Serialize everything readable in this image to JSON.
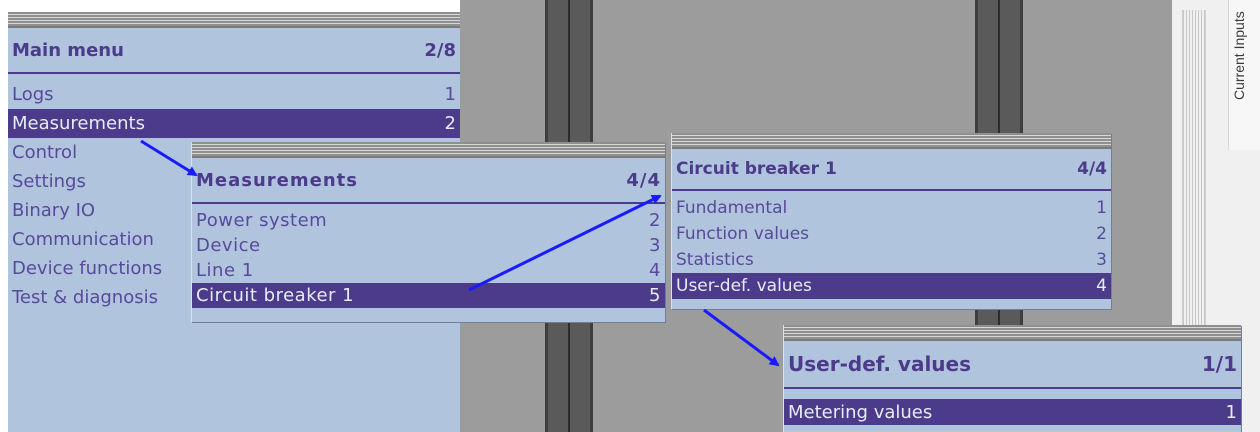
{
  "main_menu": {
    "title": "Main menu",
    "count": "2/8",
    "items": [
      {
        "label": "Logs",
        "num": "1"
      },
      {
        "label": "Measurements",
        "num": "2"
      },
      {
        "label": "Control",
        "num": ""
      },
      {
        "label": "Settings",
        "num": ""
      },
      {
        "label": "Binary IO",
        "num": ""
      },
      {
        "label": "Communication",
        "num": ""
      },
      {
        "label": "Device functions",
        "num": ""
      },
      {
        "label": "Test & diagnosis",
        "num": ""
      }
    ],
    "selected_index": 1
  },
  "measurements_menu": {
    "title": "Measurements",
    "count": "4/4",
    "items": [
      {
        "label": "Power system",
        "num": "2"
      },
      {
        "label": "Device",
        "num": "3"
      },
      {
        "label": "Line 1",
        "num": "4"
      },
      {
        "label": "Circuit breaker 1",
        "num": "5"
      }
    ],
    "selected_index": 3
  },
  "circuit_breaker_menu": {
    "title": "Circuit breaker 1",
    "count": "4/4",
    "items": [
      {
        "label": "Fundamental",
        "num": "1"
      },
      {
        "label": "Function values",
        "num": "2"
      },
      {
        "label": "Statistics",
        "num": "3"
      },
      {
        "label": "User-def. values",
        "num": "4"
      }
    ],
    "selected_index": 3
  },
  "user_def_menu": {
    "title": "User-def. values",
    "count": "1/1",
    "items": [
      {
        "label": "Metering values",
        "num": "1"
      }
    ],
    "selected_index": 0
  },
  "side_tab": {
    "label": "Current Inputs"
  },
  "colors": {
    "menu_bg": "#b0c4de",
    "accent": "#4b3b8a",
    "arrow": "#1a1aff"
  }
}
